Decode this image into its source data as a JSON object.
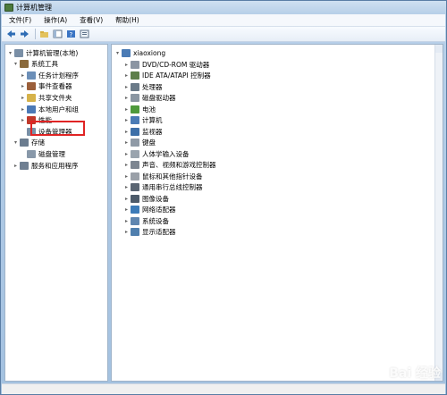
{
  "window": {
    "title": "计算机管理"
  },
  "menu": [
    "文件(F)",
    "操作(A)",
    "查看(V)",
    "帮助(H)"
  ],
  "left_tree": [
    {
      "label": "计算机管理(本地)",
      "level": 0,
      "arrow": "▾",
      "icon": "computer-mgmt-icon",
      "color": "#7a8fa6"
    },
    {
      "label": "系统工具",
      "level": 1,
      "arrow": "▾",
      "icon": "tools-icon",
      "color": "#8a6a3c"
    },
    {
      "label": "任务计划程序",
      "level": 2,
      "arrow": "▸",
      "icon": "clock-icon",
      "color": "#6c8fb8"
    },
    {
      "label": "事件查看器",
      "level": 2,
      "arrow": "▸",
      "icon": "event-viewer-icon",
      "color": "#9b5f3a"
    },
    {
      "label": "共享文件夹",
      "level": 2,
      "arrow": "▸",
      "icon": "shared-folder-icon",
      "color": "#d6b24a"
    },
    {
      "label": "本地用户和组",
      "level": 2,
      "arrow": "▸",
      "icon": "users-icon",
      "color": "#4b79b6"
    },
    {
      "label": "性能",
      "level": 2,
      "arrow": "▸",
      "icon": "performance-icon",
      "color": "#c0392b"
    },
    {
      "label": "设备管理器",
      "level": 2,
      "arrow": "",
      "icon": "device-manager-icon",
      "color": "#7a8fa6"
    },
    {
      "label": "存储",
      "level": 1,
      "arrow": "▾",
      "icon": "storage-icon",
      "color": "#6b7c8f"
    },
    {
      "label": "磁盘管理",
      "level": 2,
      "arrow": "",
      "icon": "disk-mgmt-icon",
      "color": "#8898a9"
    },
    {
      "label": "服务和应用程序",
      "level": 1,
      "arrow": "▸",
      "icon": "services-icon",
      "color": "#6f7f92"
    }
  ],
  "device_tree": {
    "root": "xiaoxiong",
    "items": [
      {
        "label": "DVD/CD-ROM 驱动器",
        "icon": "dvd-icon",
        "color": "#8b95a3"
      },
      {
        "label": "IDE ATA/ATAPI 控制器",
        "icon": "ide-icon",
        "color": "#5d7f4a"
      },
      {
        "label": "处理器",
        "icon": "cpu-icon",
        "color": "#6a7a88"
      },
      {
        "label": "磁盘驱动器",
        "icon": "disk-icon",
        "color": "#8a96a2"
      },
      {
        "label": "电池",
        "icon": "battery-icon",
        "color": "#4e9a3c"
      },
      {
        "label": "计算机",
        "icon": "computer-icon",
        "color": "#4a7bb5"
      },
      {
        "label": "监视器",
        "icon": "monitor-icon",
        "color": "#3d6fa8"
      },
      {
        "label": "键盘",
        "icon": "keyboard-icon",
        "color": "#8f9aa6"
      },
      {
        "label": "人体学输入设备",
        "icon": "hid-icon",
        "color": "#9aa4ae"
      },
      {
        "label": "声音、视频和游戏控制器",
        "icon": "sound-icon",
        "color": "#7d8691"
      },
      {
        "label": "鼠标和其他指针设备",
        "icon": "mouse-icon",
        "color": "#9aa0a8"
      },
      {
        "label": "通用串行总线控制器",
        "icon": "usb-icon",
        "color": "#5a6572"
      },
      {
        "label": "图像设备",
        "icon": "camera-icon",
        "color": "#4d5b6a"
      },
      {
        "label": "网络适配器",
        "icon": "network-icon",
        "color": "#3c7bb8"
      },
      {
        "label": "系统设备",
        "icon": "system-device-icon",
        "color": "#5f86b0"
      },
      {
        "label": "显示适配器",
        "icon": "display-adapter-icon",
        "color": "#4f7fae"
      }
    ]
  },
  "watermark": "Bai 经验"
}
